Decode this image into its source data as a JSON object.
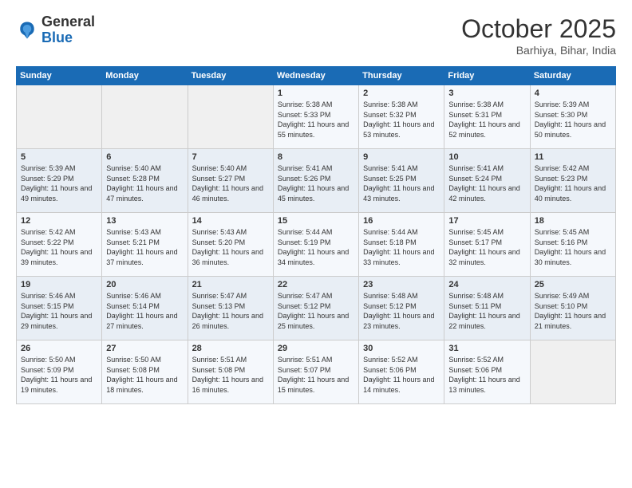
{
  "header": {
    "logo_general": "General",
    "logo_blue": "Blue",
    "month": "October 2025",
    "location": "Barhiya, Bihar, India"
  },
  "days_of_week": [
    "Sunday",
    "Monday",
    "Tuesday",
    "Wednesday",
    "Thursday",
    "Friday",
    "Saturday"
  ],
  "weeks": [
    [
      {
        "day": "",
        "sunrise": "",
        "sunset": "",
        "daylight": ""
      },
      {
        "day": "",
        "sunrise": "",
        "sunset": "",
        "daylight": ""
      },
      {
        "day": "",
        "sunrise": "",
        "sunset": "",
        "daylight": ""
      },
      {
        "day": "1",
        "sunrise": "Sunrise: 5:38 AM",
        "sunset": "Sunset: 5:33 PM",
        "daylight": "Daylight: 11 hours and 55 minutes."
      },
      {
        "day": "2",
        "sunrise": "Sunrise: 5:38 AM",
        "sunset": "Sunset: 5:32 PM",
        "daylight": "Daylight: 11 hours and 53 minutes."
      },
      {
        "day": "3",
        "sunrise": "Sunrise: 5:38 AM",
        "sunset": "Sunset: 5:31 PM",
        "daylight": "Daylight: 11 hours and 52 minutes."
      },
      {
        "day": "4",
        "sunrise": "Sunrise: 5:39 AM",
        "sunset": "Sunset: 5:30 PM",
        "daylight": "Daylight: 11 hours and 50 minutes."
      }
    ],
    [
      {
        "day": "5",
        "sunrise": "Sunrise: 5:39 AM",
        "sunset": "Sunset: 5:29 PM",
        "daylight": "Daylight: 11 hours and 49 minutes."
      },
      {
        "day": "6",
        "sunrise": "Sunrise: 5:40 AM",
        "sunset": "Sunset: 5:28 PM",
        "daylight": "Daylight: 11 hours and 47 minutes."
      },
      {
        "day": "7",
        "sunrise": "Sunrise: 5:40 AM",
        "sunset": "Sunset: 5:27 PM",
        "daylight": "Daylight: 11 hours and 46 minutes."
      },
      {
        "day": "8",
        "sunrise": "Sunrise: 5:41 AM",
        "sunset": "Sunset: 5:26 PM",
        "daylight": "Daylight: 11 hours and 45 minutes."
      },
      {
        "day": "9",
        "sunrise": "Sunrise: 5:41 AM",
        "sunset": "Sunset: 5:25 PM",
        "daylight": "Daylight: 11 hours and 43 minutes."
      },
      {
        "day": "10",
        "sunrise": "Sunrise: 5:41 AM",
        "sunset": "Sunset: 5:24 PM",
        "daylight": "Daylight: 11 hours and 42 minutes."
      },
      {
        "day": "11",
        "sunrise": "Sunrise: 5:42 AM",
        "sunset": "Sunset: 5:23 PM",
        "daylight": "Daylight: 11 hours and 40 minutes."
      }
    ],
    [
      {
        "day": "12",
        "sunrise": "Sunrise: 5:42 AM",
        "sunset": "Sunset: 5:22 PM",
        "daylight": "Daylight: 11 hours and 39 minutes."
      },
      {
        "day": "13",
        "sunrise": "Sunrise: 5:43 AM",
        "sunset": "Sunset: 5:21 PM",
        "daylight": "Daylight: 11 hours and 37 minutes."
      },
      {
        "day": "14",
        "sunrise": "Sunrise: 5:43 AM",
        "sunset": "Sunset: 5:20 PM",
        "daylight": "Daylight: 11 hours and 36 minutes."
      },
      {
        "day": "15",
        "sunrise": "Sunrise: 5:44 AM",
        "sunset": "Sunset: 5:19 PM",
        "daylight": "Daylight: 11 hours and 34 minutes."
      },
      {
        "day": "16",
        "sunrise": "Sunrise: 5:44 AM",
        "sunset": "Sunset: 5:18 PM",
        "daylight": "Daylight: 11 hours and 33 minutes."
      },
      {
        "day": "17",
        "sunrise": "Sunrise: 5:45 AM",
        "sunset": "Sunset: 5:17 PM",
        "daylight": "Daylight: 11 hours and 32 minutes."
      },
      {
        "day": "18",
        "sunrise": "Sunrise: 5:45 AM",
        "sunset": "Sunset: 5:16 PM",
        "daylight": "Daylight: 11 hours and 30 minutes."
      }
    ],
    [
      {
        "day": "19",
        "sunrise": "Sunrise: 5:46 AM",
        "sunset": "Sunset: 5:15 PM",
        "daylight": "Daylight: 11 hours and 29 minutes."
      },
      {
        "day": "20",
        "sunrise": "Sunrise: 5:46 AM",
        "sunset": "Sunset: 5:14 PM",
        "daylight": "Daylight: 11 hours and 27 minutes."
      },
      {
        "day": "21",
        "sunrise": "Sunrise: 5:47 AM",
        "sunset": "Sunset: 5:13 PM",
        "daylight": "Daylight: 11 hours and 26 minutes."
      },
      {
        "day": "22",
        "sunrise": "Sunrise: 5:47 AM",
        "sunset": "Sunset: 5:12 PM",
        "daylight": "Daylight: 11 hours and 25 minutes."
      },
      {
        "day": "23",
        "sunrise": "Sunrise: 5:48 AM",
        "sunset": "Sunset: 5:12 PM",
        "daylight": "Daylight: 11 hours and 23 minutes."
      },
      {
        "day": "24",
        "sunrise": "Sunrise: 5:48 AM",
        "sunset": "Sunset: 5:11 PM",
        "daylight": "Daylight: 11 hours and 22 minutes."
      },
      {
        "day": "25",
        "sunrise": "Sunrise: 5:49 AM",
        "sunset": "Sunset: 5:10 PM",
        "daylight": "Daylight: 11 hours and 21 minutes."
      }
    ],
    [
      {
        "day": "26",
        "sunrise": "Sunrise: 5:50 AM",
        "sunset": "Sunset: 5:09 PM",
        "daylight": "Daylight: 11 hours and 19 minutes."
      },
      {
        "day": "27",
        "sunrise": "Sunrise: 5:50 AM",
        "sunset": "Sunset: 5:08 PM",
        "daylight": "Daylight: 11 hours and 18 minutes."
      },
      {
        "day": "28",
        "sunrise": "Sunrise: 5:51 AM",
        "sunset": "Sunset: 5:08 PM",
        "daylight": "Daylight: 11 hours and 16 minutes."
      },
      {
        "day": "29",
        "sunrise": "Sunrise: 5:51 AM",
        "sunset": "Sunset: 5:07 PM",
        "daylight": "Daylight: 11 hours and 15 minutes."
      },
      {
        "day": "30",
        "sunrise": "Sunrise: 5:52 AM",
        "sunset": "Sunset: 5:06 PM",
        "daylight": "Daylight: 11 hours and 14 minutes."
      },
      {
        "day": "31",
        "sunrise": "Sunrise: 5:52 AM",
        "sunset": "Sunset: 5:06 PM",
        "daylight": "Daylight: 11 hours and 13 minutes."
      },
      {
        "day": "",
        "sunrise": "",
        "sunset": "",
        "daylight": ""
      }
    ]
  ]
}
